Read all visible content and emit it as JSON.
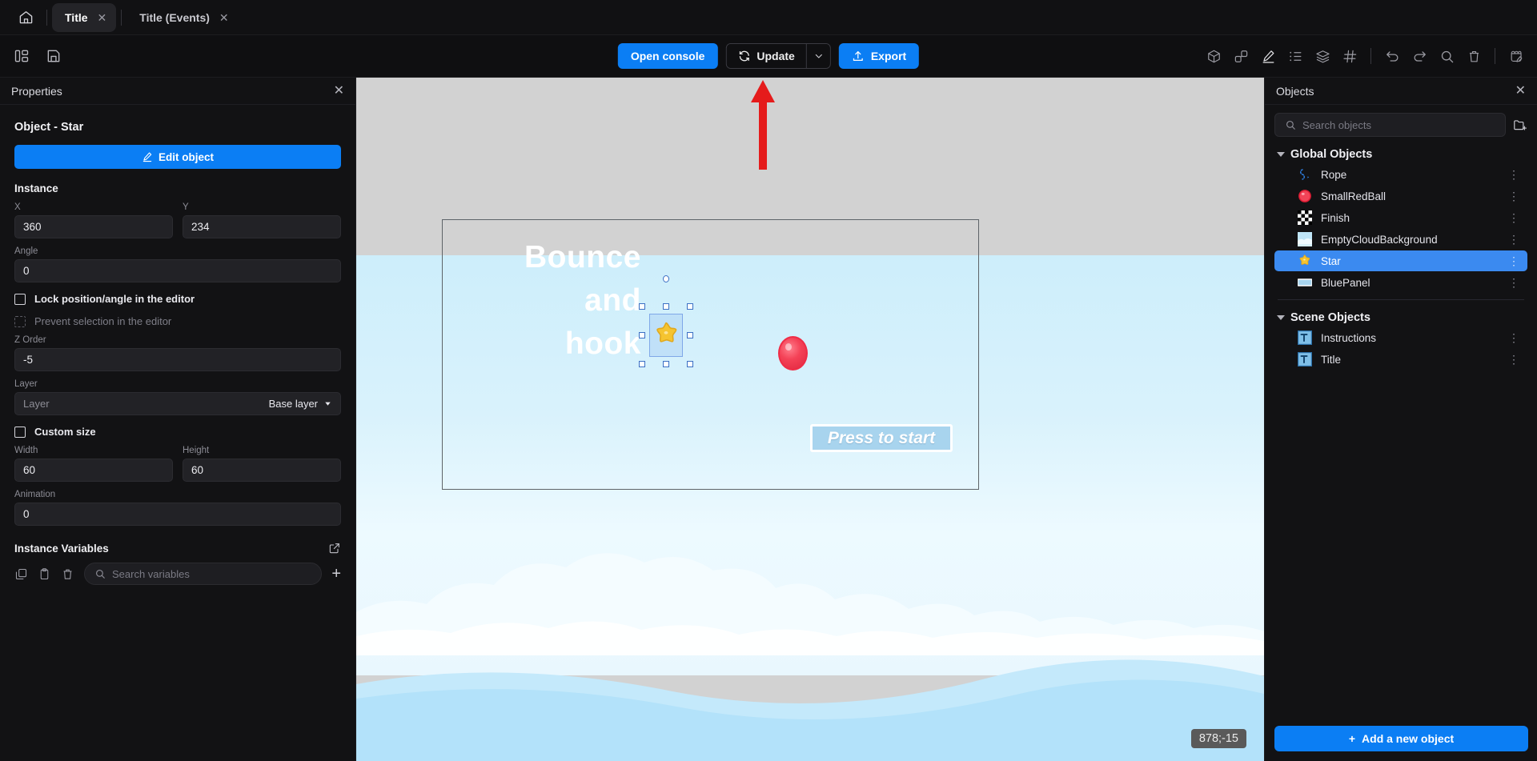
{
  "tabs": {
    "home_icon": "home-icon",
    "items": [
      {
        "label": "Title",
        "active": true,
        "close": "✕"
      },
      {
        "label": "Title (Events)",
        "active": false,
        "close": "✕"
      }
    ]
  },
  "toolbar": {
    "left_icons": [
      "panels-layout-icon",
      "save-icon"
    ],
    "open_console": "Open console",
    "update": "Update",
    "update_caret": "⌄",
    "export": "Export",
    "right_icons": [
      "cube-3d-icon",
      "objects-icon",
      "pencil-icon",
      "properties-list-icon",
      "layers-icon",
      "grid-hash-icon",
      "undo-icon",
      "redo-icon",
      "search-icon",
      "trash-icon",
      "edit-tab-icon"
    ]
  },
  "properties_panel": {
    "title": "Properties",
    "close": "✕",
    "object_title": "Object - Star",
    "edit_object": "Edit object",
    "instance_section": "Instance",
    "x_label": "X",
    "x_value": "360",
    "y_label": "Y",
    "y_value": "234",
    "angle_label": "Angle",
    "angle_value": "0",
    "lock_position": "Lock position/angle in the editor",
    "prevent_selection": "Prevent selection in the editor",
    "z_order_label": "Z Order",
    "z_order_value": "-5",
    "layer_label": "Layer",
    "layer_placeholder": "Layer",
    "layer_value": "Base layer",
    "custom_size": "Custom size",
    "width_label": "Width",
    "width_value": "60",
    "height_label": "Height",
    "height_value": "60",
    "animation_label": "Animation",
    "animation_value": "0",
    "instance_variables": "Instance Variables",
    "search_variables_placeholder": "Search variables",
    "add_variable": "+"
  },
  "objects_panel": {
    "title": "Objects",
    "close": "✕",
    "search_placeholder": "Search objects",
    "groups": [
      {
        "name": "Global Objects",
        "items": [
          {
            "label": "Rope",
            "icon": "rope-object-icon",
            "selected": false
          },
          {
            "label": "SmallRedBall",
            "icon": "red-ball-object-icon",
            "selected": false
          },
          {
            "label": "Finish",
            "icon": "checker-flag-object-icon",
            "selected": false
          },
          {
            "label": "EmptyCloudBackground",
            "icon": "cloud-background-object-icon",
            "selected": false
          },
          {
            "label": "Star",
            "icon": "star-object-icon",
            "selected": true
          },
          {
            "label": "BluePanel",
            "icon": "blue-panel-object-icon",
            "selected": false
          }
        ]
      },
      {
        "name": "Scene Objects",
        "items": [
          {
            "label": "Instructions",
            "icon": "text-object-icon",
            "selected": false
          },
          {
            "label": "Title",
            "icon": "text-object-icon",
            "selected": false
          }
        ]
      }
    ],
    "add_new_object": "Add a new object"
  },
  "canvas": {
    "game_title_lines": [
      "Bounce",
      "and",
      "hook"
    ],
    "press_to_start": "Press to start",
    "coordinates": "878;-15"
  },
  "colors": {
    "accent_blue": "#0b7ef4",
    "selection_blue": "#3b8af0",
    "panel_bg": "#121214",
    "canvas_gray": "#d2d2d2",
    "sky_blue": "#cdeefb",
    "annotation_red": "#e51b1b"
  }
}
